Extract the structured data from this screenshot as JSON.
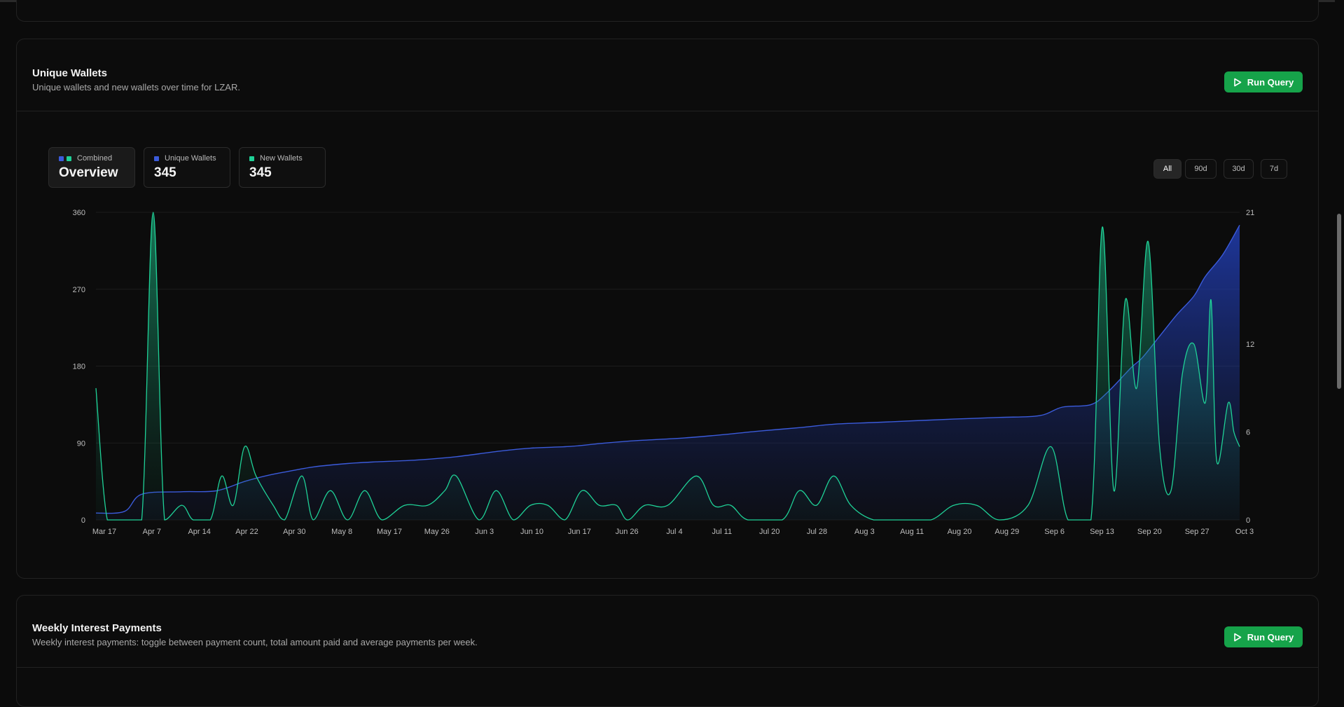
{
  "unique_wallets": {
    "title": "Unique Wallets",
    "description": "Unique wallets and new wallets over time for LZAR.",
    "run_label": "Run Query",
    "legend": {
      "combined": {
        "label": "Combined",
        "value": "Overview"
      },
      "unique": {
        "label": "Unique Wallets",
        "value": "345"
      },
      "new": {
        "label": "New Wallets",
        "value": "345"
      }
    },
    "ranges": [
      "All",
      "90d",
      "30d",
      "7d"
    ],
    "active_range": "All"
  },
  "weekly_interest": {
    "title": "Weekly Interest Payments",
    "description": "Weekly interest payments: toggle between payment count, total amount paid and average payments per week.",
    "run_label": "Run Query"
  },
  "colors": {
    "accent_green": "#16a34a",
    "unique_line": "#3b5bdb",
    "new_line": "#1fd197"
  },
  "chart_data": {
    "type": "area",
    "x_ticks": [
      "Mar 17",
      "Apr 7",
      "Apr 14",
      "Apr 22",
      "Apr 30",
      "May 8",
      "May 17",
      "May 26",
      "Jun 3",
      "Jun 10",
      "Jun 17",
      "Jun 26",
      "Jul 4",
      "Jul 11",
      "Jul 20",
      "Jul 28",
      "Aug 3",
      "Aug 11",
      "Aug 20",
      "Aug 29",
      "Sep 6",
      "Sep 13",
      "Sep 20",
      "Sep 27",
      "Oct 3"
    ],
    "x_range": [
      "2025-03-17",
      "2025-10-03"
    ],
    "y_left_ticks": [
      "0",
      "90",
      "180",
      "270",
      "360"
    ],
    "y_left_range": [
      0,
      360
    ],
    "y_right_ticks": [
      "0",
      "6",
      "12",
      "21"
    ],
    "y_right_range": [
      0,
      21
    ],
    "grid": true,
    "series": [
      {
        "name": "Unique Wallets",
        "axis": "left",
        "points": [
          [
            "2025-03-17",
            8
          ],
          [
            "2025-03-22",
            10
          ],
          [
            "2025-03-25",
            30
          ],
          [
            "2025-04-01",
            33
          ],
          [
            "2025-04-07",
            34
          ],
          [
            "2025-04-12",
            45
          ],
          [
            "2025-04-16",
            52
          ],
          [
            "2025-04-19",
            56
          ],
          [
            "2025-04-24",
            62
          ],
          [
            "2025-04-30",
            66
          ],
          [
            "2025-05-05",
            68
          ],
          [
            "2025-05-12",
            70
          ],
          [
            "2025-05-19",
            74
          ],
          [
            "2025-05-26",
            80
          ],
          [
            "2025-06-01",
            84
          ],
          [
            "2025-06-08",
            86
          ],
          [
            "2025-06-14",
            90
          ],
          [
            "2025-06-20",
            93
          ],
          [
            "2025-06-28",
            96
          ],
          [
            "2025-07-05",
            100
          ],
          [
            "2025-07-11",
            104
          ],
          [
            "2025-07-18",
            108
          ],
          [
            "2025-07-24",
            112
          ],
          [
            "2025-07-31",
            114
          ],
          [
            "2025-08-07",
            116
          ],
          [
            "2025-08-14",
            118
          ],
          [
            "2025-08-22",
            120
          ],
          [
            "2025-08-29",
            122
          ],
          [
            "2025-09-02",
            132
          ],
          [
            "2025-09-07",
            135
          ],
          [
            "2025-09-10",
            150
          ],
          [
            "2025-09-14",
            178
          ],
          [
            "2025-09-16",
            190
          ],
          [
            "2025-09-19",
            215
          ],
          [
            "2025-09-22",
            240
          ],
          [
            "2025-09-25",
            262
          ],
          [
            "2025-09-27",
            285
          ],
          [
            "2025-09-30",
            310
          ],
          [
            "2025-10-03",
            345
          ]
        ]
      },
      {
        "name": "New Wallets",
        "axis": "right",
        "points": [
          [
            "2025-03-17",
            9
          ],
          [
            "2025-03-19",
            0
          ],
          [
            "2025-03-22",
            0
          ],
          [
            "2025-03-25",
            0
          ],
          [
            "2025-03-27",
            21
          ],
          [
            "2025-03-29",
            0
          ],
          [
            "2025-04-01",
            1
          ],
          [
            "2025-04-03",
            0
          ],
          [
            "2025-04-06",
            0
          ],
          [
            "2025-04-08",
            3
          ],
          [
            "2025-04-10",
            1
          ],
          [
            "2025-04-12",
            5
          ],
          [
            "2025-04-14",
            3
          ],
          [
            "2025-04-17",
            1
          ],
          [
            "2025-04-19",
            0
          ],
          [
            "2025-04-22",
            3
          ],
          [
            "2025-04-24",
            0
          ],
          [
            "2025-04-27",
            2
          ],
          [
            "2025-04-30",
            0
          ],
          [
            "2025-05-03",
            2
          ],
          [
            "2025-05-06",
            0
          ],
          [
            "2025-05-10",
            1
          ],
          [
            "2025-05-14",
            1
          ],
          [
            "2025-05-17",
            2
          ],
          [
            "2025-05-19",
            3
          ],
          [
            "2025-05-23",
            0
          ],
          [
            "2025-05-26",
            2
          ],
          [
            "2025-05-29",
            0
          ],
          [
            "2025-06-01",
            1
          ],
          [
            "2025-06-04",
            1
          ],
          [
            "2025-06-07",
            0
          ],
          [
            "2025-06-10",
            2
          ],
          [
            "2025-06-13",
            1
          ],
          [
            "2025-06-16",
            1
          ],
          [
            "2025-06-18",
            0
          ],
          [
            "2025-06-21",
            1
          ],
          [
            "2025-06-25",
            1
          ],
          [
            "2025-06-30",
            3
          ],
          [
            "2025-07-03",
            1
          ],
          [
            "2025-07-06",
            1
          ],
          [
            "2025-07-09",
            0
          ],
          [
            "2025-07-15",
            0
          ],
          [
            "2025-07-18",
            2
          ],
          [
            "2025-07-21",
            1
          ],
          [
            "2025-07-24",
            3
          ],
          [
            "2025-07-27",
            1
          ],
          [
            "2025-07-31",
            0
          ],
          [
            "2025-08-05",
            0
          ],
          [
            "2025-08-10",
            0
          ],
          [
            "2025-08-14",
            1
          ],
          [
            "2025-08-18",
            1
          ],
          [
            "2025-08-22",
            0
          ],
          [
            "2025-08-27",
            1
          ],
          [
            "2025-08-31",
            5
          ],
          [
            "2025-09-03",
            0
          ],
          [
            "2025-09-07",
            0
          ],
          [
            "2025-09-09",
            20
          ],
          [
            "2025-09-11",
            2
          ],
          [
            "2025-09-13",
            15
          ],
          [
            "2025-09-15",
            9
          ],
          [
            "2025-09-17",
            19
          ],
          [
            "2025-09-19",
            5
          ],
          [
            "2025-09-21",
            2
          ],
          [
            "2025-09-23",
            10
          ],
          [
            "2025-09-25",
            12
          ],
          [
            "2025-09-27",
            8
          ],
          [
            "2025-09-28",
            15
          ],
          [
            "2025-09-29",
            4
          ],
          [
            "2025-10-01",
            8
          ],
          [
            "2025-10-02",
            6
          ],
          [
            "2025-10-03",
            5
          ]
        ]
      }
    ]
  }
}
